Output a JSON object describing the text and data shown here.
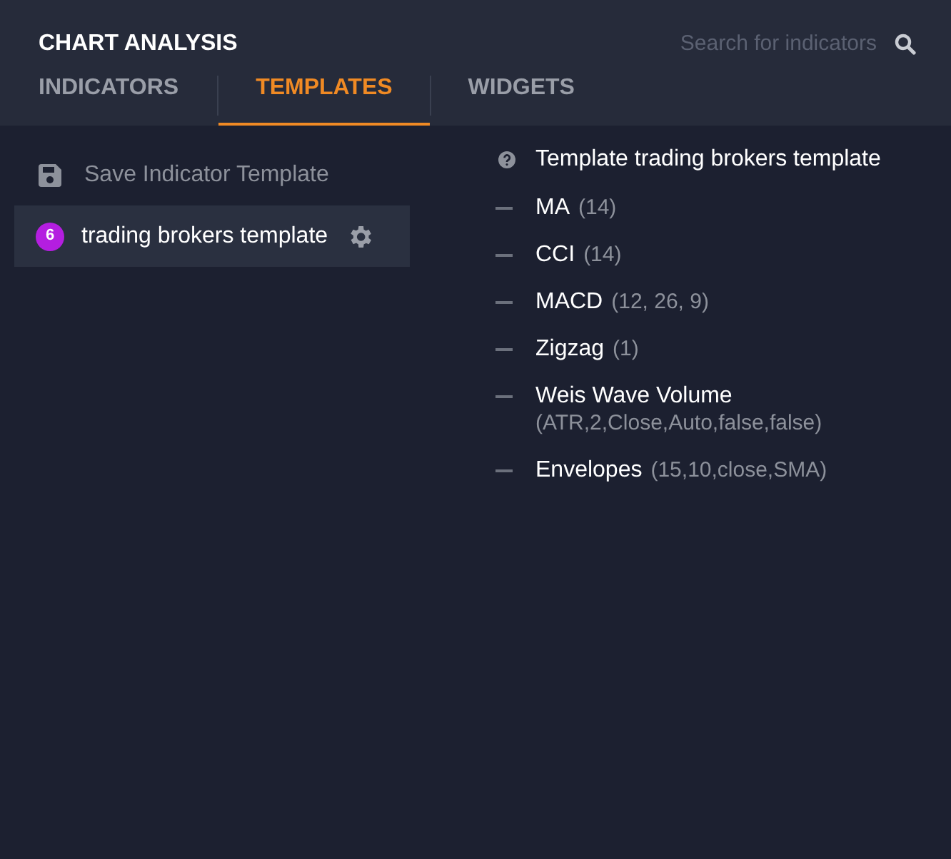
{
  "window": {
    "title": "CHART ANALYSIS"
  },
  "search": {
    "placeholder": "Search for indicators"
  },
  "tabs": [
    {
      "label": "INDICATORS",
      "selected": false
    },
    {
      "label": "TEMPLATES",
      "selected": true
    },
    {
      "label": "WIDGETS",
      "selected": false
    }
  ],
  "save_action": {
    "label": "Save Indicator Template"
  },
  "templates": [
    {
      "count": "6",
      "color": "#b41ee0",
      "label": "trading brokers template",
      "selected": true
    }
  ],
  "details": {
    "title": "Template trading brokers template",
    "indicators": [
      {
        "name": "MA",
        "params": "(14)"
      },
      {
        "name": "CCI",
        "params": "(14)"
      },
      {
        "name": "MACD",
        "params": "(12, 26, 9)"
      },
      {
        "name": "Zigzag",
        "params": "(1)"
      },
      {
        "name": "Weis Wave Volume",
        "params": "(ATR,2,Close,Auto,false,false)"
      },
      {
        "name": "Envelopes",
        "params": "(15,10,close,SMA)"
      }
    ]
  }
}
